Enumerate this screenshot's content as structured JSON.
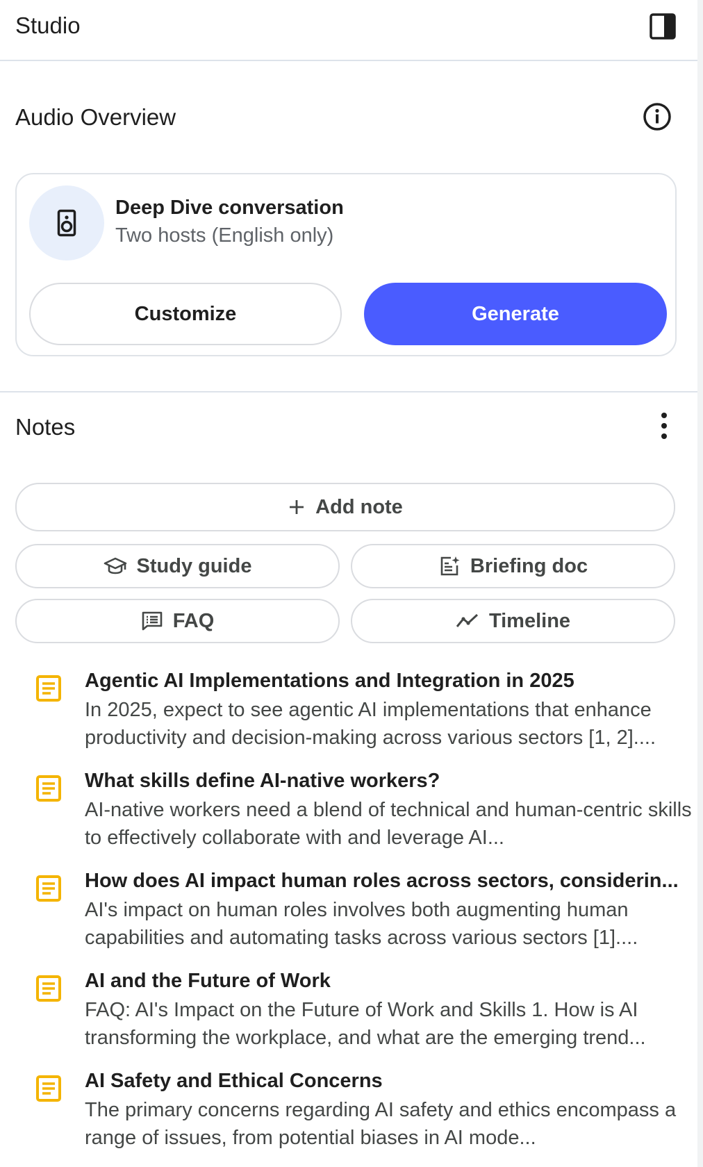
{
  "header": {
    "title": "Studio",
    "toggle_icon": "side-panel-icon"
  },
  "audio_overview": {
    "title": "Audio Overview",
    "info_icon": "info-icon",
    "card": {
      "icon": "speaker-icon",
      "title": "Deep Dive conversation",
      "subtitle": "Two hosts (English only)",
      "customize_label": "Customize",
      "generate_label": "Generate"
    }
  },
  "notes": {
    "title": "Notes",
    "menu_icon": "more-vert-icon",
    "add_note_label": "Add note",
    "quick_actions": [
      {
        "label": "Study guide",
        "icon": "school-icon"
      },
      {
        "label": "Briefing doc",
        "icon": "briefing-doc-icon"
      },
      {
        "label": "FAQ",
        "icon": "faq-icon"
      },
      {
        "label": "Timeline",
        "icon": "timeline-icon"
      }
    ],
    "items": [
      {
        "title": "Agentic AI Implementations and Integration in 2025",
        "body": "In 2025, expect to see agentic AI implementations that enhance productivity and decision-making across various sectors [1, 2]...."
      },
      {
        "title": "What skills define AI-native workers?",
        "body": "AI-native workers need a blend of technical and human-centric skills to effectively collaborate with and leverage AI..."
      },
      {
        "title": "How does AI impact human roles across sectors, considerin...",
        "body": "AI's impact on human roles involves both augmenting human capabilities and automating tasks across various sectors [1]...."
      },
      {
        "title": "AI and the Future of Work",
        "body": "FAQ: AI's Impact on the Future of Work and Skills 1. How is AI transforming the workplace, and what are the emerging trend..."
      },
      {
        "title": "AI Safety and Ethical Concerns",
        "body": "The primary concerns regarding AI safety and ethics encompass a range of issues, from potential biases in AI mode..."
      }
    ]
  },
  "colors": {
    "accent": "#4a5cff",
    "note_icon": "#f4b400",
    "speaker_bg": "#e8effb"
  }
}
